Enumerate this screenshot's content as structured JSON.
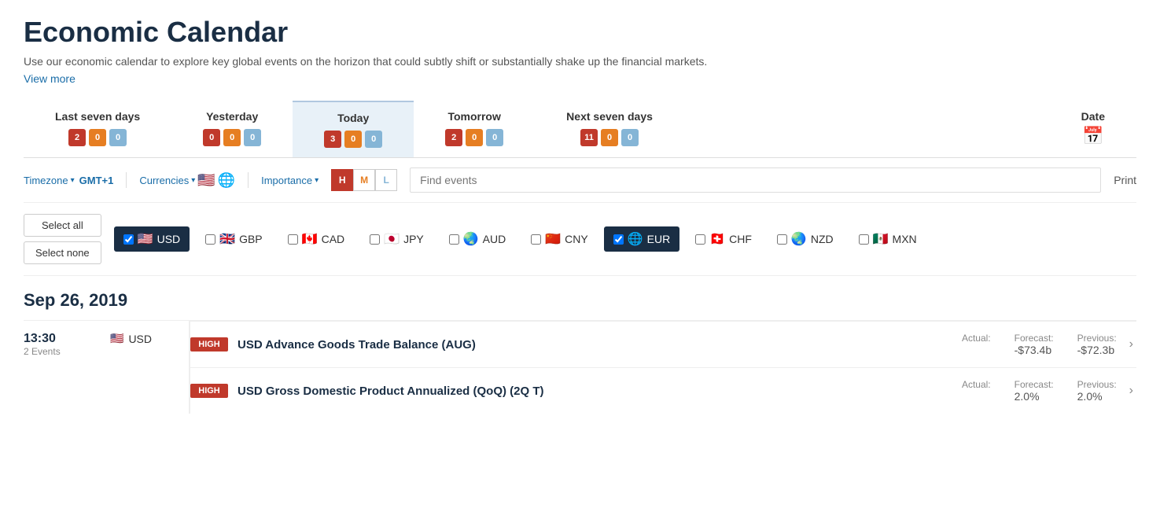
{
  "page": {
    "title": "Economic Calendar",
    "description": "Use our economic calendar to explore key global events on the horizon that could subtly shift or substantially shake up the financial markets.",
    "view_more": "View more"
  },
  "tabs": [
    {
      "id": "last7",
      "label": "Last seven days",
      "badges": [
        2,
        0,
        0
      ]
    },
    {
      "id": "yesterday",
      "label": "Yesterday",
      "badges": [
        0,
        0,
        0
      ]
    },
    {
      "id": "today",
      "label": "Today",
      "badges": [
        3,
        0,
        0
      ],
      "active": true
    },
    {
      "id": "tomorrow",
      "label": "Tomorrow",
      "badges": [
        2,
        0,
        0
      ]
    },
    {
      "id": "next7",
      "label": "Next seven days",
      "badges": [
        11,
        0,
        0
      ]
    },
    {
      "id": "date",
      "label": "Date"
    }
  ],
  "filters": {
    "timezone_label": "Timezone",
    "timezone_value": "GMT+1",
    "currencies_label": "Currencies",
    "importance_label": "Importance",
    "importance_h": "H",
    "importance_m": "M",
    "importance_l": "L",
    "search_placeholder": "Find events",
    "print_label": "Print"
  },
  "currency_selector": {
    "select_all": "Select all",
    "select_none": "Select none",
    "currencies": [
      {
        "code": "USD",
        "flag": "🇺🇸",
        "selected": true
      },
      {
        "code": "GBP",
        "flag": "🇬🇧",
        "selected": false
      },
      {
        "code": "CAD",
        "flag": "🇨🇦",
        "selected": false
      },
      {
        "code": "JPY",
        "flag": "🇯🇵",
        "selected": false
      },
      {
        "code": "AUD",
        "flag": "🌏",
        "selected": false
      },
      {
        "code": "CNY",
        "flag": "🇨🇳",
        "selected": false
      },
      {
        "code": "EUR",
        "flag": "🇪🇺",
        "selected": true
      },
      {
        "code": "CHF",
        "flag": "🇨🇭",
        "selected": false
      },
      {
        "code": "NZD",
        "flag": "🌏",
        "selected": false
      },
      {
        "code": "MXN",
        "flag": "🇲🇽",
        "selected": false
      }
    ]
  },
  "date_section": {
    "date_label": "Sep 26, 2019",
    "time": "13:30",
    "event_count": "2 Events",
    "currency": "USD",
    "events": [
      {
        "importance": "HIGH",
        "name": "USD Advance Goods Trade Balance (AUG)",
        "actual_label": "Actual:",
        "actual_value": "",
        "forecast_label": "Forecast:",
        "forecast_value": "-$73.4b",
        "previous_label": "Previous:",
        "previous_value": "-$72.3b"
      },
      {
        "importance": "HIGH",
        "name": "USD Gross Domestic Product Annualized (QoQ) (2Q T)",
        "actual_label": "Actual:",
        "actual_value": "",
        "forecast_label": "Forecast:",
        "forecast_value": "2.0%",
        "previous_label": "Previous:",
        "previous_value": "2.0%"
      }
    ]
  }
}
